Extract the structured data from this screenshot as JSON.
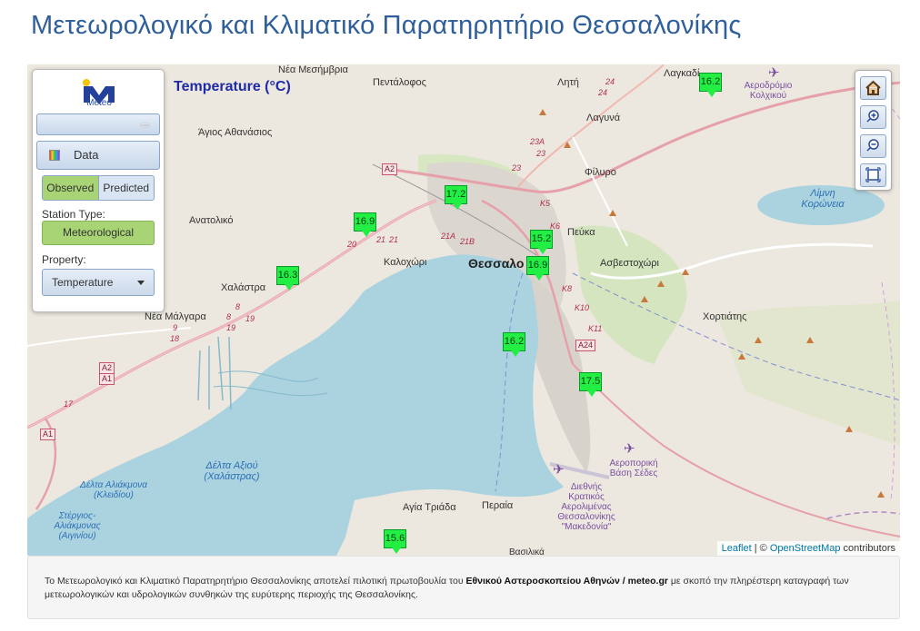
{
  "page": {
    "title": "Μετεωρολογικό και Κλιματικό Παρατηρητήριο Θεσσαλονίκης"
  },
  "map": {
    "chart_title": "Temperature (°C)",
    "labels": {
      "nea_mesimvria": "Νέα Μεσήμβρια",
      "pentalofos": "Πεντάλοφος",
      "liti": "Λητή",
      "lagkadikia": "Λαγκαδί",
      "laguna": "Λαγυνά",
      "airport_kolchiko": "Αεροδρόμιο Κολχικού",
      "agios_athanasios": "Άγιος Αθανάσιος",
      "filyro": "Φίλυρο",
      "limni_koroneia": "Λίμνη Κορώνεια",
      "anatoliko": "Ανατολικό",
      "peuka": "Πεύκα",
      "kalochori": "Καλοχώρι",
      "thessaloniki": "Θεσσαλο",
      "asvestochori": "Ασβεστοχώρι",
      "chalastra": "Χαλάστρα",
      "nea_malgara": "Νέα Μάλγαρα",
      "chortiatis": "Χορτιάτης",
      "delta_axiou": "Δέλτα Αξιού (Χαλάστρας)",
      "delta_aliakmona": "Δέλτα Αλιάκμονα (Κλειδίου)",
      "stergios": "Στέργιος-Αλιάκμονας (Αιγινίου)",
      "agia_triada": "Αγία Τριάδα",
      "peraia": "Περαία",
      "airport_sedes": "Αεροπορική Βάση Σέδες",
      "airport_makedonia": "Διεθνής Κρατικός Αερολιμένας Θεσσαλονίκης \"Μακεδονία\"",
      "vasilika": "Βασιλικά"
    },
    "road_labels": [
      "A2",
      "A1",
      "A2",
      "A1",
      "A24",
      "24",
      "24",
      "23A",
      "23",
      "23",
      "K5",
      "K6",
      "K8",
      "K10",
      "K11",
      "21A",
      "21B",
      "21",
      "21",
      "20",
      "9",
      "18",
      "8",
      "8",
      "19",
      "19",
      "17"
    ],
    "markers": [
      {
        "value": "16.2"
      },
      {
        "value": "17.2"
      },
      {
        "value": "16.9"
      },
      {
        "value": "15.2"
      },
      {
        "value": "16.9"
      },
      {
        "value": "16.3"
      },
      {
        "value": "16.2"
      },
      {
        "value": "17.5"
      },
      {
        "value": "15.6"
      }
    ],
    "attribution": {
      "leaflet": "Leaflet",
      "separator": " | © ",
      "osm": "OpenStreetMap",
      "contributors": " contributors"
    }
  },
  "control": {
    "logo_text": "Meteo",
    "collapse_icon": "arrow-left-icon",
    "data_label": "Data",
    "toggle": {
      "observed": "Observed",
      "predicted": "Predicted",
      "active": "Observed"
    },
    "station_type_label": "Station Type:",
    "station_type_value": "Meteorological",
    "property_label": "Property:",
    "property_value": "Temperature"
  },
  "zoom_controls": {
    "home_icon": "home-icon",
    "zoom_in_icon": "zoom-in-icon",
    "zoom_out_icon": "zoom-out-icon",
    "fullscreen_icon": "fullscreen-icon"
  },
  "footer": {
    "text_before": "Το Μετεωρολογικό και Κλιματικό Παρατηρητήριο Θεσσαλονίκης αποτελεί πιλοτική πρωτοβουλία του ",
    "bold": "Εθνικού Αστεροσκοπείου Αθηνών / meteo.gr",
    "text_after": " με σκοπό την πληρέστερη καταγραφή των μετεωρολογικών και υδρολογικών συνθηκών της ευρύτερης περιοχής της Θεσσαλονίκης."
  },
  "colors": {
    "title": "#2f5f9a",
    "marker": "#22ee44",
    "sea": "#aad3df",
    "active_toggle": "#a8d475"
  }
}
